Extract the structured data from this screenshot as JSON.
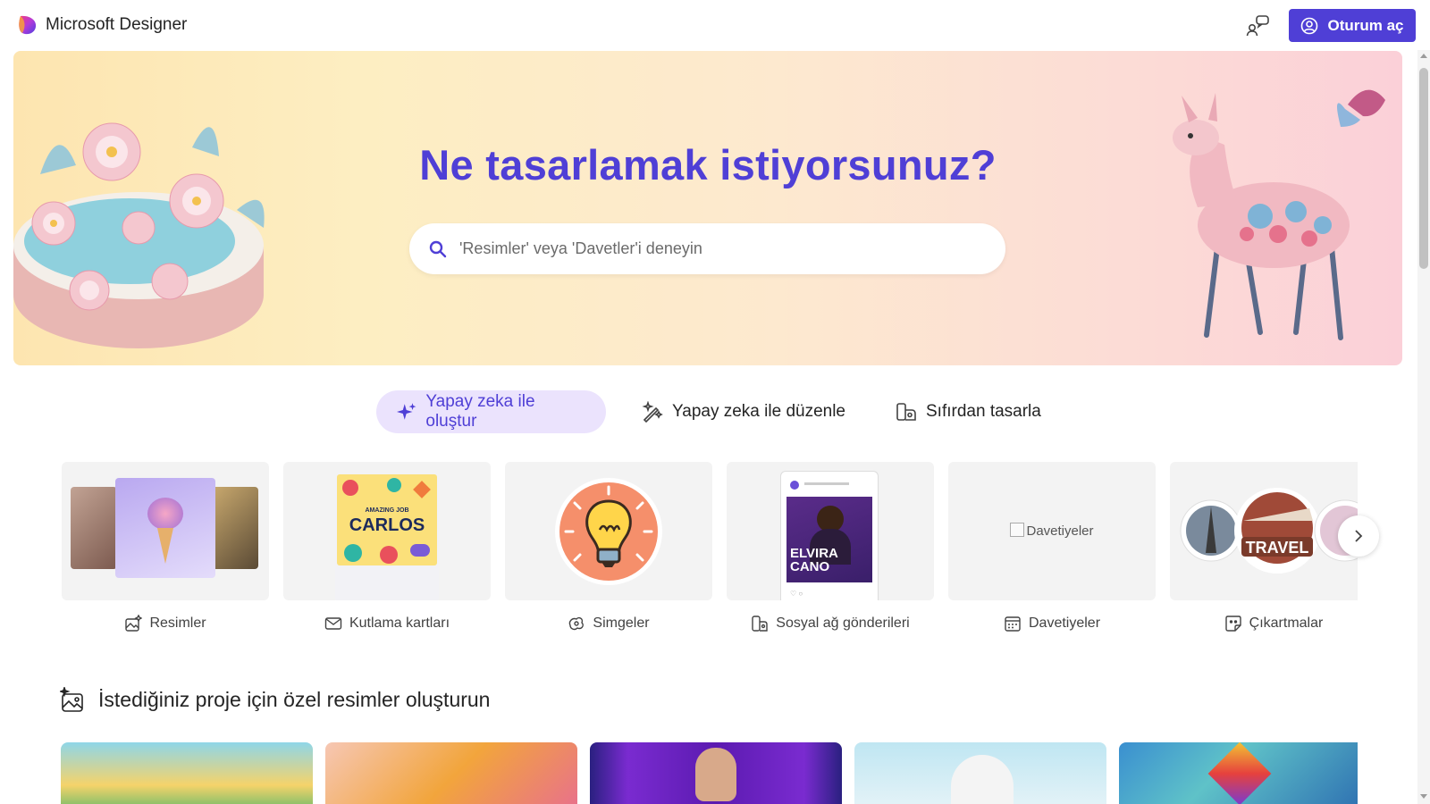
{
  "app": {
    "name": "Microsoft Designer"
  },
  "header": {
    "signin_label": "Oturum aç"
  },
  "hero": {
    "title": "Ne tasarlamak istiyorsunuz?",
    "search_placeholder": "'Resimler' veya 'Davetler'i deneyin",
    "search_value": ""
  },
  "tabs": [
    {
      "label": "Yapay zeka ile oluştur",
      "active": true,
      "icon": "sparkle-icon"
    },
    {
      "label": "Yapay zeka ile düzenle",
      "active": false,
      "icon": "magic-wand-icon"
    },
    {
      "label": "Sıfırdan tasarla",
      "active": false,
      "icon": "design-icon"
    }
  ],
  "categories": [
    {
      "label": "Resimler",
      "icon": "image-sparkle-icon"
    },
    {
      "label": "Kutlama kartları",
      "icon": "mail-icon",
      "card_text_top": "AMAZING JOB",
      "card_text_main": "CARLOS"
    },
    {
      "label": "Simgeler",
      "icon": "icon-shapes-icon"
    },
    {
      "label": "Sosyal ağ gönderileri",
      "icon": "social-post-icon",
      "card_text": "ELVIRA CANO"
    },
    {
      "label": "Davetiyeler",
      "icon": "calendar-icon",
      "broken_image_alt": "Davetiyeler"
    },
    {
      "label": "Çıkartmalar",
      "icon": "sticker-icon",
      "card_text": "TRAVEL"
    }
  ],
  "section": {
    "title": "İstediğiniz proje için özel resimler oluşturun",
    "icon": "image-sparkle-icon"
  },
  "colors": {
    "accent": "#4f3fd6",
    "accent_soft": "#ebe3fd",
    "card_bg": "#f3f3f3"
  }
}
